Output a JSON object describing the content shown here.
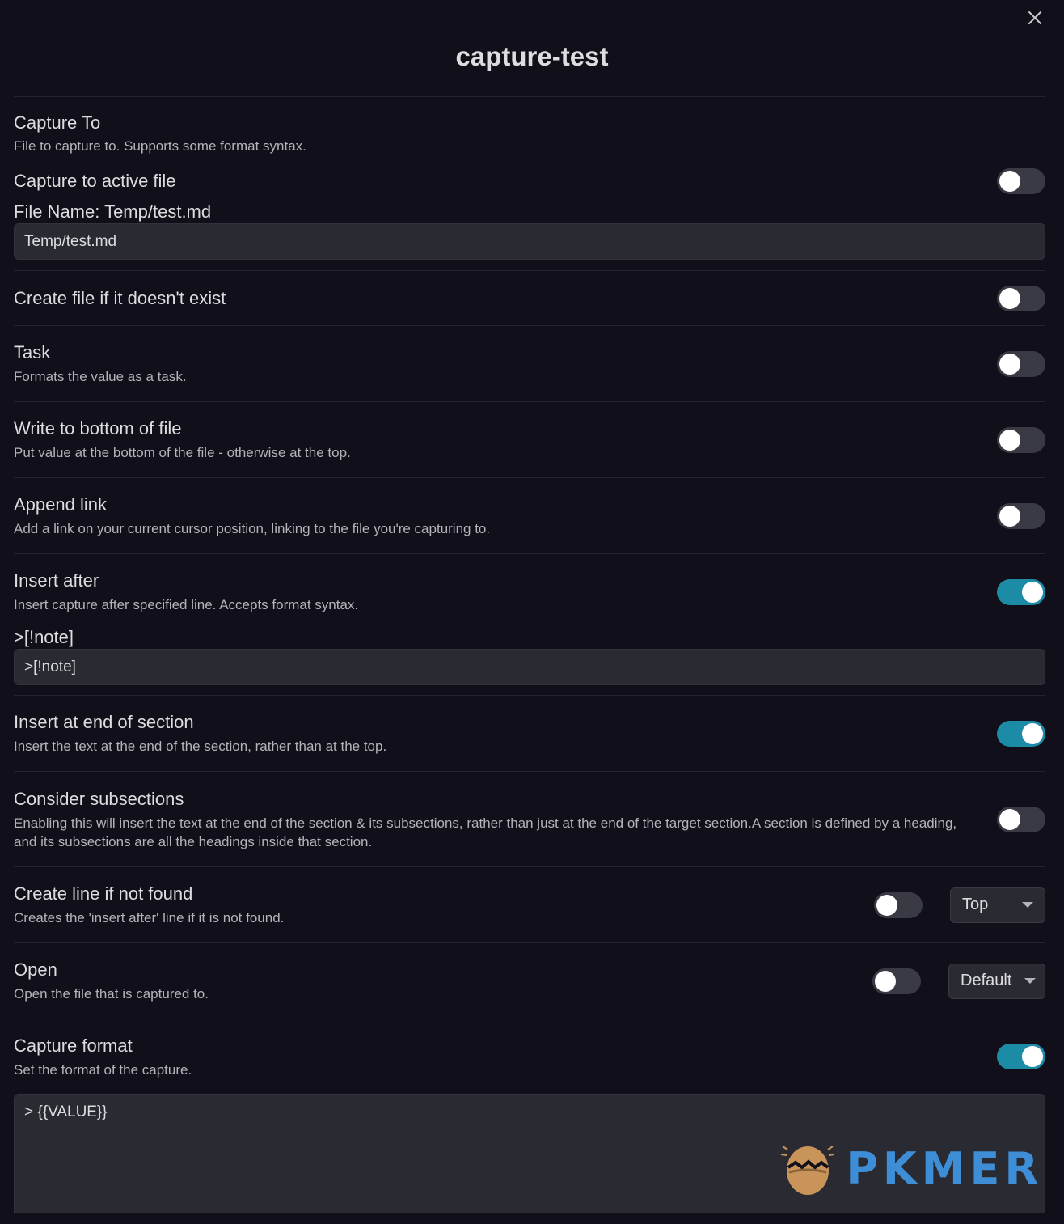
{
  "modal": {
    "title": "capture-test",
    "close_icon": "close-icon"
  },
  "capture_to": {
    "name": "Capture To",
    "desc": "File to capture to. Supports some format syntax."
  },
  "capture_to_active_file": {
    "name": "Capture to active file",
    "enabled": false
  },
  "file_name": {
    "label": "File Name: Temp/test.md",
    "value": "Temp/test.md"
  },
  "create_file": {
    "name": "Create file if it doesn't exist",
    "enabled": false
  },
  "task": {
    "name": "Task",
    "desc": "Formats the value as a task.",
    "enabled": false
  },
  "write_bottom": {
    "name": "Write to bottom of file",
    "desc": "Put value at the bottom of the file - otherwise at the top.",
    "enabled": false
  },
  "append_link": {
    "name": "Append link",
    "desc": "Add a link on your current cursor position, linking to the file you're capturing to.",
    "enabled": false
  },
  "insert_after": {
    "name": "Insert after",
    "desc": "Insert capture after specified line. Accepts format syntax.",
    "enabled": true,
    "label": ">[!note]",
    "value": ">[!note]"
  },
  "insert_end_section": {
    "name": "Insert at end of section",
    "desc": "Insert the text at the end of the section, rather than at the top.",
    "enabled": true
  },
  "consider_subsections": {
    "name": "Consider subsections",
    "desc": "Enabling this will insert the text at the end of the section & its subsections, rather than just at the end of the target section.A section is defined by a heading, and its subsections are all the headings inside that section.",
    "enabled": false
  },
  "create_line": {
    "name": "Create line if not found",
    "desc": "Creates the 'insert after' line if it is not found.",
    "enabled": false,
    "select_value": "Top"
  },
  "open": {
    "name": "Open",
    "desc": "Open the file that is captured to.",
    "enabled": false,
    "select_value": "Default"
  },
  "capture_format": {
    "name": "Capture format",
    "desc": "Set the format of the capture.",
    "enabled": true,
    "value": "> {{VALUE}}"
  },
  "watermark": {
    "text": "PKMER",
    "colors": {
      "text": "#3d8ed6",
      "egg": "#c8945a"
    }
  },
  "colors": {
    "background": "#11101a",
    "toggle_on": "#1c8ba6",
    "toggle_off": "#3a3a45",
    "input_bg": "#2a2a32"
  }
}
